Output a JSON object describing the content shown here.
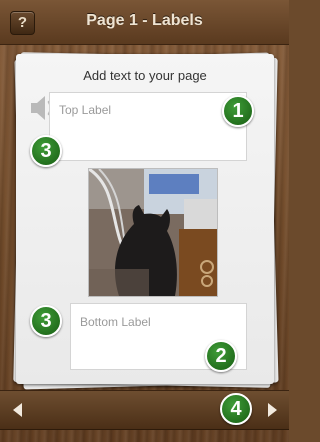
{
  "header": {
    "title": "Page 1 - Labels",
    "help_label": "?"
  },
  "page": {
    "prompt": "Add text to your page",
    "top_label_placeholder": "Top Label",
    "bottom_label_placeholder": "Bottom Label"
  },
  "badges": {
    "top_label": "1",
    "bottom_label": "2",
    "speaker": "3",
    "bottom_left": "3",
    "navigation": "4"
  },
  "icons": {
    "speaker": "speaker-icon",
    "prev": "arrow-left-icon",
    "next": "arrow-right-icon"
  },
  "colors": {
    "badge": "#2d7d26",
    "wood": "#6b4a2c"
  }
}
